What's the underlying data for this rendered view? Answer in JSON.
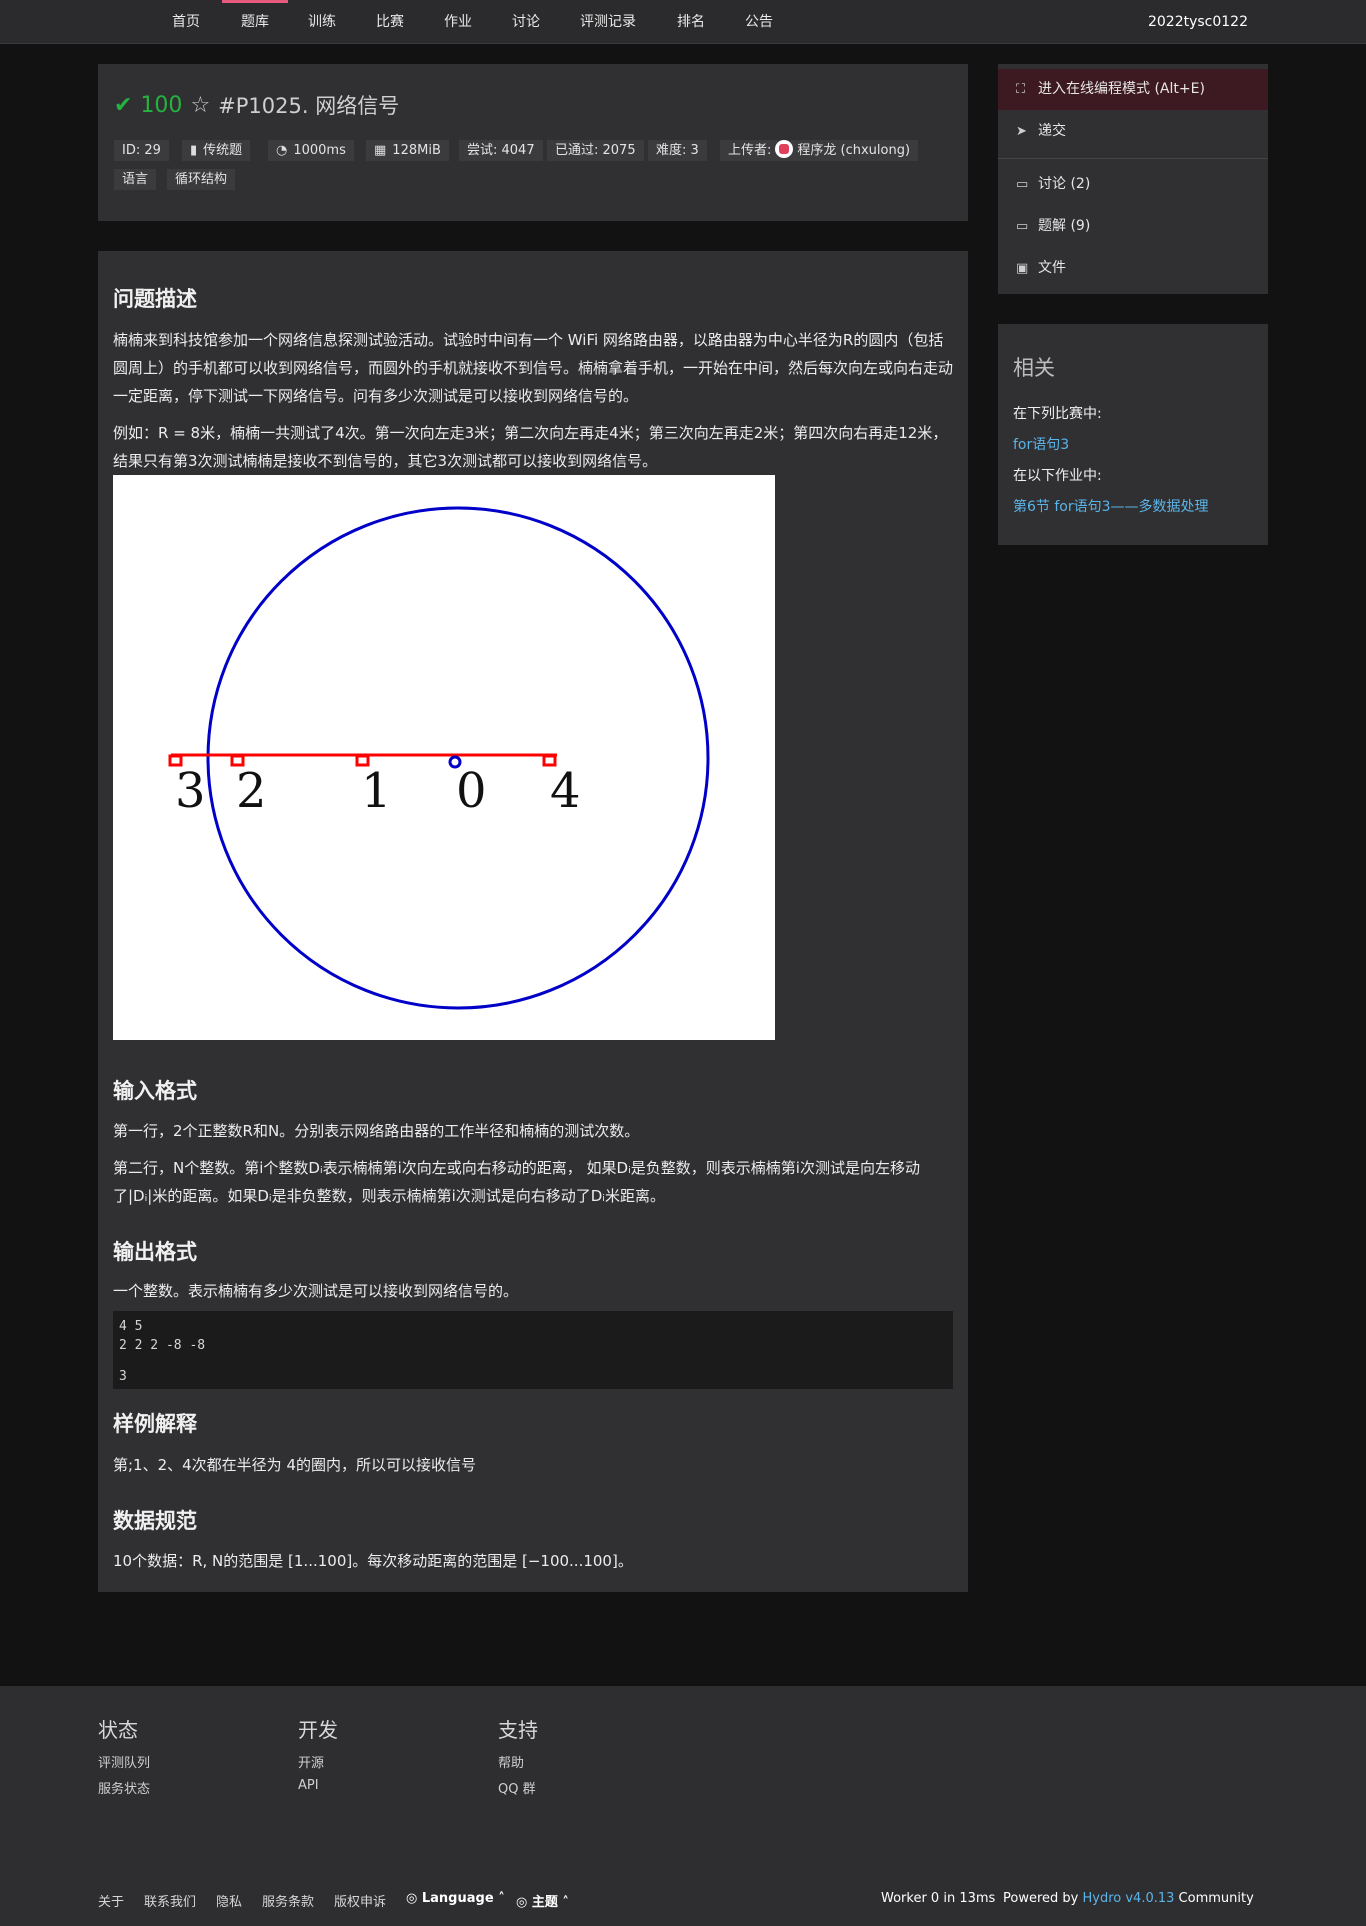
{
  "nav": {
    "items": [
      "首页",
      "题库",
      "训练",
      "比赛",
      "作业",
      "讨论",
      "评测记录",
      "排名",
      "公告"
    ],
    "active": "题库",
    "user": "2022tysc0122"
  },
  "header": {
    "score": "100",
    "title": "#P1025. 网络信号",
    "tags": {
      "id": "ID: 29",
      "type": "传统题",
      "time": "1000ms",
      "memory": "128MiB",
      "tried": "尝试: 4047",
      "accepted": "已通过: 2075",
      "difficulty": "难度: 3",
      "uploader_label": "上传者:",
      "uploader": "程序龙 (chxulong)",
      "tag1": "语言",
      "tag2": "循环结构"
    }
  },
  "content": {
    "desc_title": "问题描述",
    "desc_p1": "楠楠来到科技馆参加一个网络信息探测试验活动。试验时中间有一个 WiFi 网络路由器，以路由器为中心半径为R的圆内（包括圆周上）的手机都可以收到网络信号，而圆外的手机就接收不到信号。楠楠拿着手机，一开始在中间，然后每次向左或向右走动一定距离，停下测试一下网络信号。问有多少次测试是可以接收到网络信号的。",
    "desc_p2": "例如：R = 8米，楠楠一共测试了4次。第一次向左走3米；第二次向左再走4米；第三次向左再走2米；第四次向右再走12米，结果只有第3次测试楠楠是接收不到信号的，其它3次测试都可以接收到网络信号。",
    "figure_labels": [
      "3",
      "2",
      "1",
      "0",
      "4"
    ],
    "input_title": "输入格式",
    "input_p1": "第一行，2个正整数R和N。分别表示网络路由器的工作半径和楠楠的测试次数。",
    "input_p2": "第二行，N个整数。第i个整数Dᵢ表示楠楠第i次向左或向右移动的距离， 如果Dᵢ是负整数，则表示楠楠第i次测试是向左移动了|Dᵢ|米的距离。如果Dᵢ是非负整数，则表示楠楠第i次测试是向右移动了Dᵢ米距离。",
    "output_title": "输出格式",
    "output_p1": "一个整数。表示楠楠有多少次测试是可以接收到网络信号的。",
    "sample_input_1": "4 5",
    "sample_input_2": "2 2 2 -8 -8",
    "sample_output": "3",
    "explain_title": "样例解释",
    "explain_p": "第;1、2、4次都在半径为 4的圈内，所以可以接收信号",
    "limit_title": "数据规范",
    "limit_p": "10个数据：R, N的范围是 [1...100]。每次移动距离的范围是 [−100...100]。"
  },
  "sidebar": {
    "online_mode": "进入在线编程模式 (Alt+E)",
    "submit": "递交",
    "discuss": "讨论 (2)",
    "solutions": "题解 (9)",
    "files": "文件",
    "related_title": "相关",
    "contest_label": "在下列比赛中:",
    "contest_link": "for语句3",
    "homework_label": "在以下作业中:",
    "homework_link": "第6节 for语句3——多数据处理"
  },
  "footer": {
    "col1_title": "状态",
    "col1_links": [
      "评测队列",
      "服务状态"
    ],
    "col2_title": "开发",
    "col2_links": [
      "开源",
      "API"
    ],
    "col3_title": "支持",
    "col3_links": [
      "帮助",
      "QQ 群"
    ],
    "bottom_links": [
      "关于",
      "联系我们",
      "隐私",
      "服务条款",
      "版权申诉"
    ],
    "language": "Language",
    "theme": "主题",
    "worker": "Worker 0 in 13ms",
    "powered_prefix": "Powered by ",
    "powered_link": "Hydro v4.0.13",
    "powered_suffix": " Community"
  }
}
